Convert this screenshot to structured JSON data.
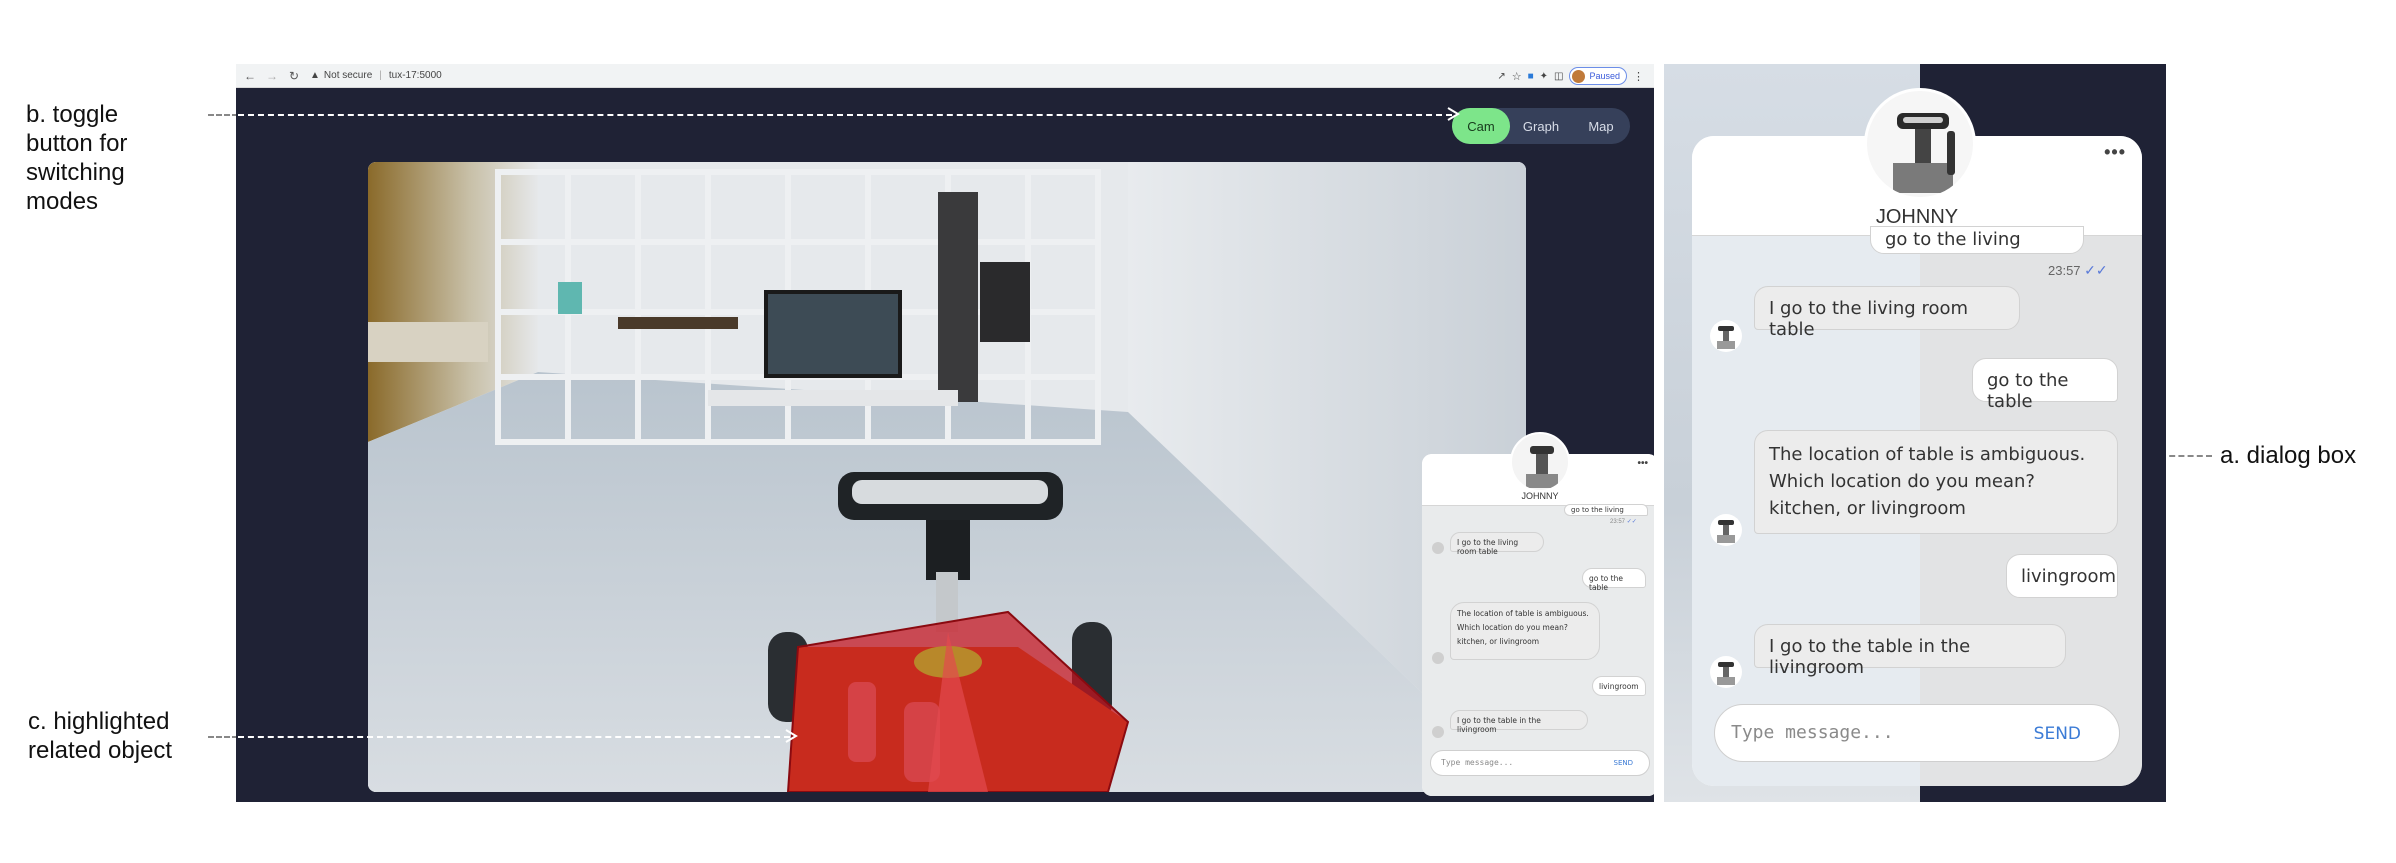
{
  "annotations": {
    "toggle": [
      "b. toggle",
      "button for",
      "switching",
      "modes"
    ],
    "object": [
      "c. highlighted",
      "related object"
    ],
    "dialog": "a. dialog box"
  },
  "browser": {
    "security": "Not secure",
    "url": "tux-17:5000",
    "profile_status": "Paused"
  },
  "toggle": {
    "options": [
      "Cam",
      "Graph",
      "Map"
    ],
    "active": "Cam"
  },
  "dialog": {
    "bot_name": "JOHNNY",
    "menu": "•••",
    "messages": [
      {
        "role": "user",
        "text": "go to the living room table",
        "time": "23:57",
        "ticks": "✓✓"
      },
      {
        "role": "bot",
        "text": "I go to the living room table"
      },
      {
        "role": "user",
        "text": "go to the table"
      },
      {
        "role": "bot",
        "text": "The location of table is ambiguous. Which location do you mean? kitchen, or livingroom"
      },
      {
        "role": "user",
        "text": "livingroom"
      },
      {
        "role": "bot",
        "text": "I go to the table in the livingroom"
      }
    ],
    "input_placeholder": "Type message...",
    "send_label": "SEND"
  },
  "colors": {
    "window_bg": "#1f2235",
    "toggle_active": "#7de58a",
    "send": "#3b7bd6",
    "highlight": "#c8141e"
  }
}
